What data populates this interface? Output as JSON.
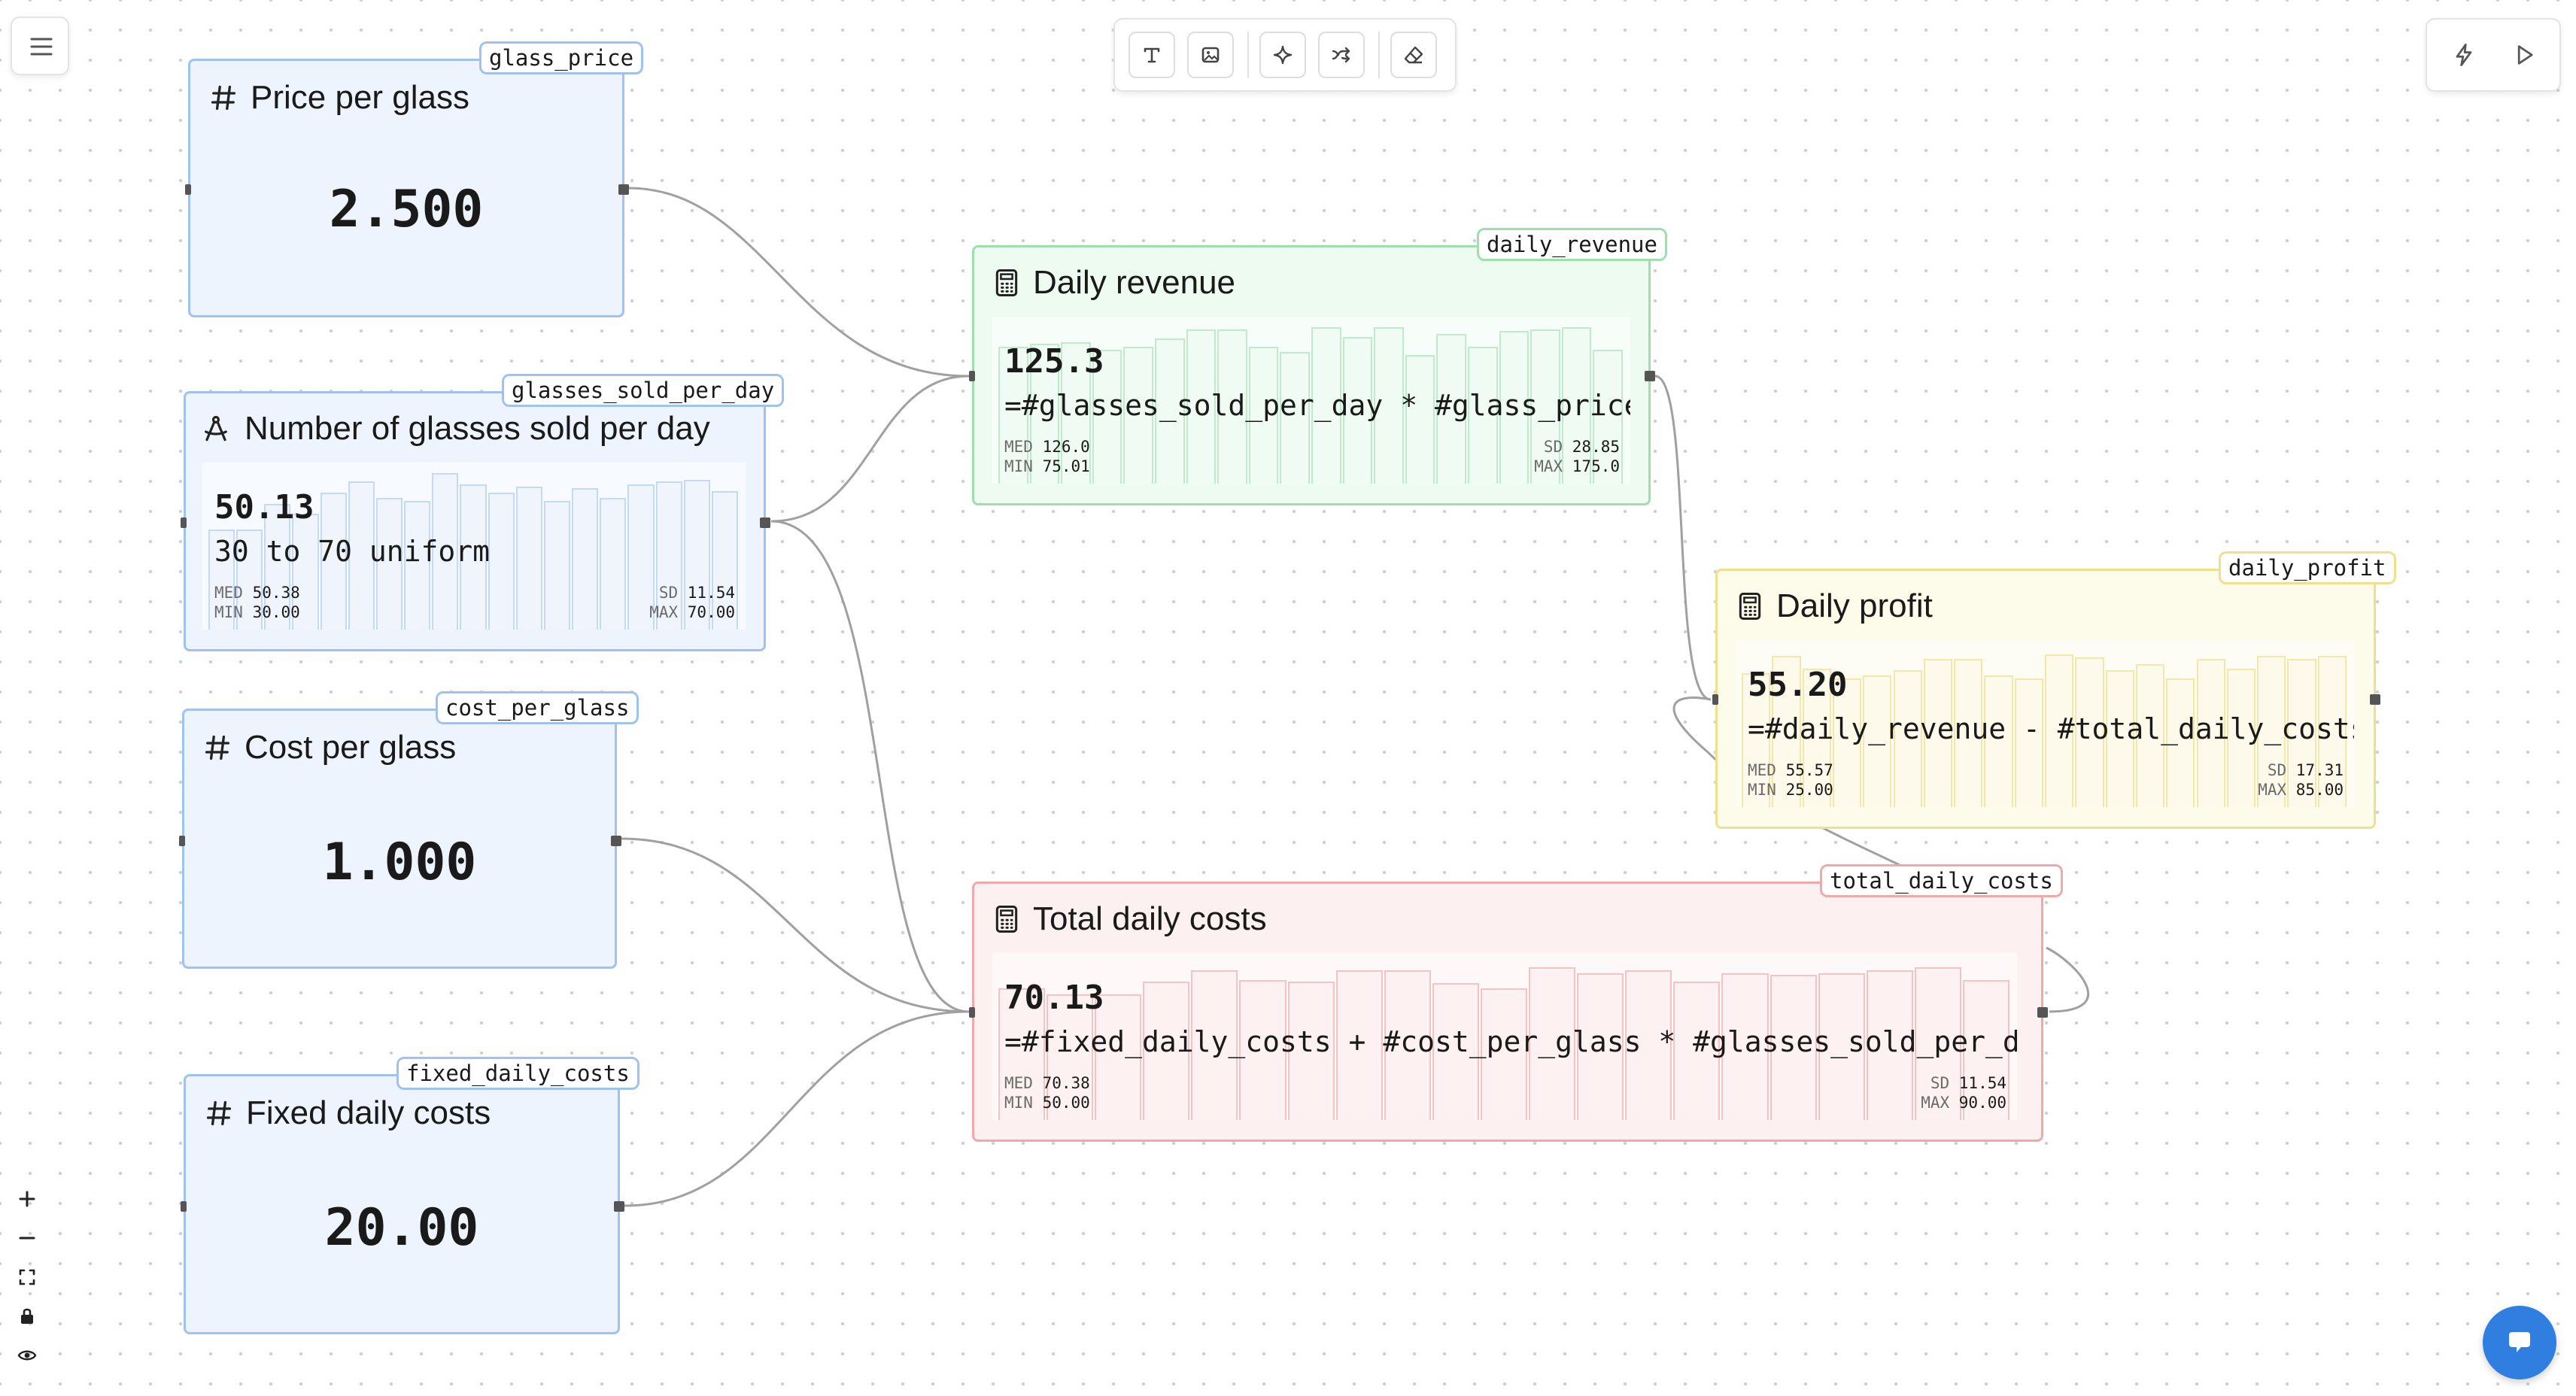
{
  "toolbar": {
    "tools": [
      {
        "icon": "text-icon",
        "label": "Text"
      },
      {
        "icon": "image-icon",
        "label": "Image"
      },
      {
        "icon": "sparkle-icon",
        "label": "AI"
      },
      {
        "icon": "shuffle-icon",
        "label": "Connect"
      },
      {
        "icon": "eraser-icon",
        "label": "Erase"
      }
    ],
    "run": [
      {
        "icon": "lightning-icon"
      },
      {
        "icon": "play-icon"
      }
    ]
  },
  "nodes": {
    "glass_price": {
      "tag": "glass_price",
      "title": "Price per glass",
      "value": "2.500",
      "icon": "hash-icon"
    },
    "glasses_sold_per_day": {
      "tag": "glasses_sold_per_day",
      "title": "Number of glasses sold per day",
      "icon": "compass-icon",
      "mean": "50.13",
      "formula": "30 to 70 uniform",
      "stats": {
        "med_label": "MED",
        "med": "50.38",
        "min_label": "MIN",
        "min": "30.00",
        "sd_label": "SD",
        "sd": "11.54",
        "max_label": "MAX",
        "max": "70.00"
      },
      "histogram": [
        0.62,
        0.62,
        0.78,
        0.72,
        0.85,
        0.92,
        0.82,
        0.8,
        0.97,
        0.9,
        0.85,
        0.89,
        0.8,
        0.88,
        0.82,
        0.9,
        0.92,
        0.93,
        0.86
      ]
    },
    "cost_per_glass": {
      "tag": "cost_per_glass",
      "title": "Cost per glass",
      "value": "1.000",
      "icon": "hash-icon"
    },
    "fixed_daily_costs": {
      "tag": "fixed_daily_costs",
      "title": "Fixed daily costs",
      "value": "20.00",
      "icon": "hash-icon"
    },
    "daily_revenue": {
      "tag": "daily_revenue",
      "title": "Daily revenue",
      "icon": "calculator-icon",
      "mean": "125.3",
      "formula": "=#glasses_sold_per_day * #glass_price",
      "stats": {
        "med_label": "MED",
        "med": "126.0",
        "min_label": "MIN",
        "min": "75.01",
        "sd_label": "SD",
        "sd": "28.85",
        "max_label": "MAX",
        "max": "175.0"
      },
      "histogram": [
        0.85,
        0.87,
        0.88,
        0.83,
        0.85,
        0.9,
        0.96,
        0.96,
        0.85,
        0.82,
        0.97,
        0.91,
        0.97,
        0.8,
        0.93,
        0.85,
        0.95,
        0.96,
        0.97,
        0.83
      ]
    },
    "daily_profit": {
      "tag": "daily_profit",
      "title": "Daily profit",
      "icon": "calculator-icon",
      "mean": "55.20",
      "formula": "=#daily_revenue - #total_daily_costs",
      "stats": {
        "med_label": "MED",
        "med": "55.57",
        "min_label": "MIN",
        "min": "25.00",
        "sd_label": "SD",
        "sd": "17.31",
        "max_label": "MAX",
        "max": "85.00"
      },
      "histogram": [
        0.83,
        0.94,
        0.86,
        0.8,
        0.82,
        0.85,
        0.92,
        0.92,
        0.82,
        0.8,
        0.95,
        0.93,
        0.85,
        0.89,
        0.8,
        0.92,
        0.86,
        0.94,
        0.92,
        0.94
      ]
    },
    "total_daily_costs": {
      "tag": "total_daily_costs",
      "title": "Total daily costs",
      "icon": "calculator-icon",
      "mean": "70.13",
      "formula": "=#fixed_daily_costs + #cost_per_glass * #glasses_sold_per_day",
      "stats": {
        "med_label": "MED",
        "med": "70.38",
        "min_label": "MIN",
        "min": "50.00",
        "sd_label": "SD",
        "sd": "11.54",
        "max_label": "MAX",
        "max": "90.00"
      },
      "histogram": [
        0.82,
        0.78,
        0.78,
        0.86,
        0.93,
        0.87,
        0.86,
        0.93,
        0.93,
        0.85,
        0.82,
        0.95,
        0.91,
        0.93,
        0.86,
        0.91,
        0.9,
        0.91,
        0.93,
        0.95,
        0.87
      ]
    }
  },
  "canvas_controls": [
    {
      "icon": "plus-icon"
    },
    {
      "icon": "minus-icon"
    },
    {
      "icon": "fit-view-icon"
    },
    {
      "icon": "lock-icon"
    },
    {
      "icon": "eye-icon"
    }
  ],
  "menu": {
    "icon": "hamburger-menu-icon"
  },
  "chat": {
    "icon": "chat-bubble-icon"
  }
}
